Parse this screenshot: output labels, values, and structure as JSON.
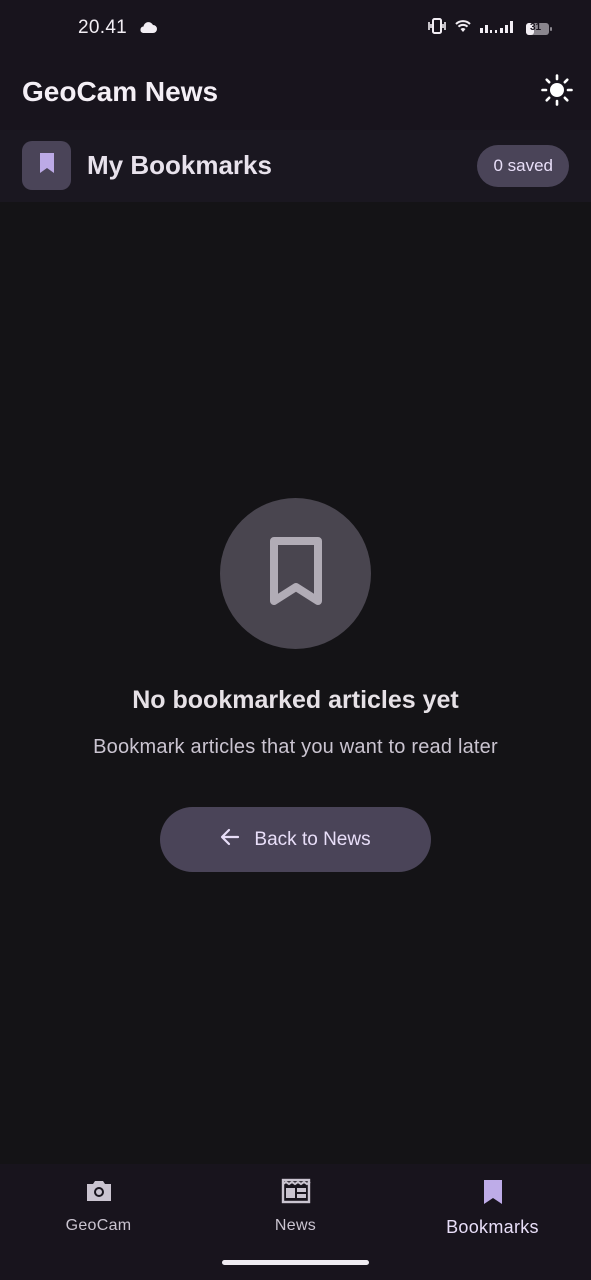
{
  "status_bar": {
    "time": "20.41",
    "battery": "31"
  },
  "app_bar": {
    "title": "GeoCam News",
    "theme_icon": "sun-icon"
  },
  "section": {
    "title": "My Bookmarks",
    "saved_count": "0 saved",
    "icon": "bookmark-icon"
  },
  "empty_state": {
    "icon": "bookmark-outline-icon",
    "title": "No bookmarked articles yet",
    "subtitle": "Bookmark articles that you want to read later",
    "button_label": "Back to News",
    "button_icon": "arrow-left-icon"
  },
  "bottom_nav": {
    "items": [
      {
        "label": "GeoCam",
        "icon": "camera-icon",
        "active": false
      },
      {
        "label": "News",
        "icon": "newspaper-icon",
        "active": false
      },
      {
        "label": "Bookmarks",
        "icon": "bookmark-icon",
        "active": true
      }
    ]
  },
  "colors": {
    "background": "#141316",
    "surface": "#18141d",
    "accent_container": "#4a4458",
    "on_accent": "#e8def8"
  }
}
